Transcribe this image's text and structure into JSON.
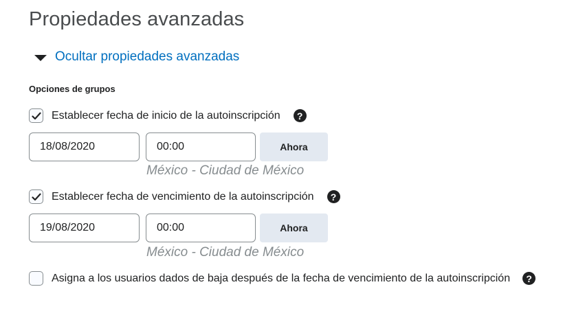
{
  "page": {
    "title": "Propiedades avanzadas",
    "toggle_label": "Ocultar propiedades avanzadas",
    "section_label": "Opciones de grupos"
  },
  "start": {
    "checked": true,
    "label": "Establecer fecha de inicio de la autoinscripción",
    "help_icon": "?",
    "date": "18/08/2020",
    "time": "00:00",
    "now_button": "Ahora",
    "timezone": "México - Ciudad de México"
  },
  "end": {
    "checked": true,
    "label": "Establecer fecha de vencimiento de la autoinscripción",
    "help_icon": "?",
    "date": "19/08/2020",
    "time": "00:00",
    "now_button": "Ahora",
    "timezone": "México - Ciudad de México"
  },
  "assign": {
    "checked": false,
    "label": "Asigna a los usuarios dados de baja después de la fecha de vencimiento de la autoinscripción",
    "help_icon": "?"
  },
  "icons": {
    "toggle": "caret-down-icon",
    "check": "checkmark-icon",
    "help": "help-circle-icon"
  },
  "colors": {
    "link": "#006fbf",
    "title": "#494c4e",
    "button_bg": "#e3e9f1",
    "timezone": "#868c8f"
  }
}
